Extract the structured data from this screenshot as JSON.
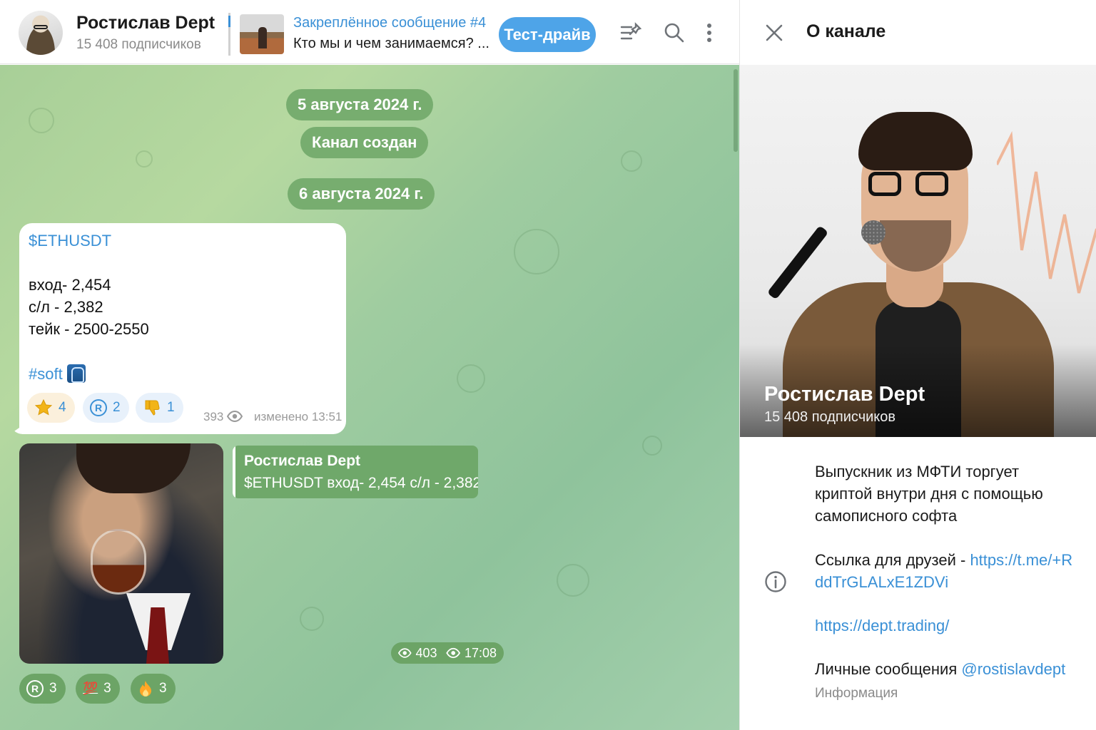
{
  "header": {
    "channel_name": "Ростислав Dept",
    "subscribers": "15 408 подписчиков",
    "pinned_title": "Закреплённое сообщение #4",
    "pinned_text": "Кто мы и чем занимаемся? ...",
    "test_drive_label": "Тест-драйв",
    "icons": [
      "pinned-list-icon",
      "search-icon",
      "more-vertical-icon"
    ]
  },
  "chat": {
    "date1": "5 августа 2024 г.",
    "service_created": "Канал создан",
    "date2": "6 августа 2024 г.",
    "message": {
      "ticker": "$ETHUSDT",
      "entry": "вход- 2,454",
      "stop": "с/л - 2,382",
      "take": "тейк - 2500-2550",
      "hashtag": "#soft",
      "reactions": [
        {
          "icon": "star-icon",
          "count": "4"
        },
        {
          "icon": "registered-icon",
          "count": "2"
        },
        {
          "icon": "thumbs-down-icon",
          "count": "1"
        }
      ],
      "views": "393",
      "edited": "изменено 13:51"
    },
    "reply": {
      "name": "Ростислав Dept",
      "text": "$ETHUSDT вход- 2,454 с/л - 2,382..."
    },
    "photo_message": {
      "views": "403",
      "time": "17:08",
      "reactions": [
        {
          "icon": "registered-icon",
          "count": "3"
        },
        {
          "icon": "hundred-icon",
          "glyph": "💯",
          "count": "3"
        },
        {
          "icon": "fire-icon",
          "count": "3"
        }
      ]
    }
  },
  "info_panel": {
    "title": "О канале",
    "cover_name": "Ростислав Dept",
    "cover_subs": "15 408 подписчиков",
    "desc_line1": "Выпускник из МФТИ торгует",
    "desc_line2": "криптой внутри дня с помощью",
    "desc_line3": "самописного софта",
    "friends_label": "Ссылка для друзей - ",
    "friends_link_part1": "https://t.me/+R",
    "friends_link_part2": "ddTrGLALxE1ZDVi",
    "site_link": "https://dept.trading/",
    "pm_label": "Личные сообщения ",
    "pm_handle": "@rostislavdept",
    "caption": "Информация"
  },
  "colors": {
    "accent": "#3a90d6",
    "button": "#4ea4e8",
    "pill": "#77ad6f",
    "chat_bg": "#a8cf98"
  }
}
